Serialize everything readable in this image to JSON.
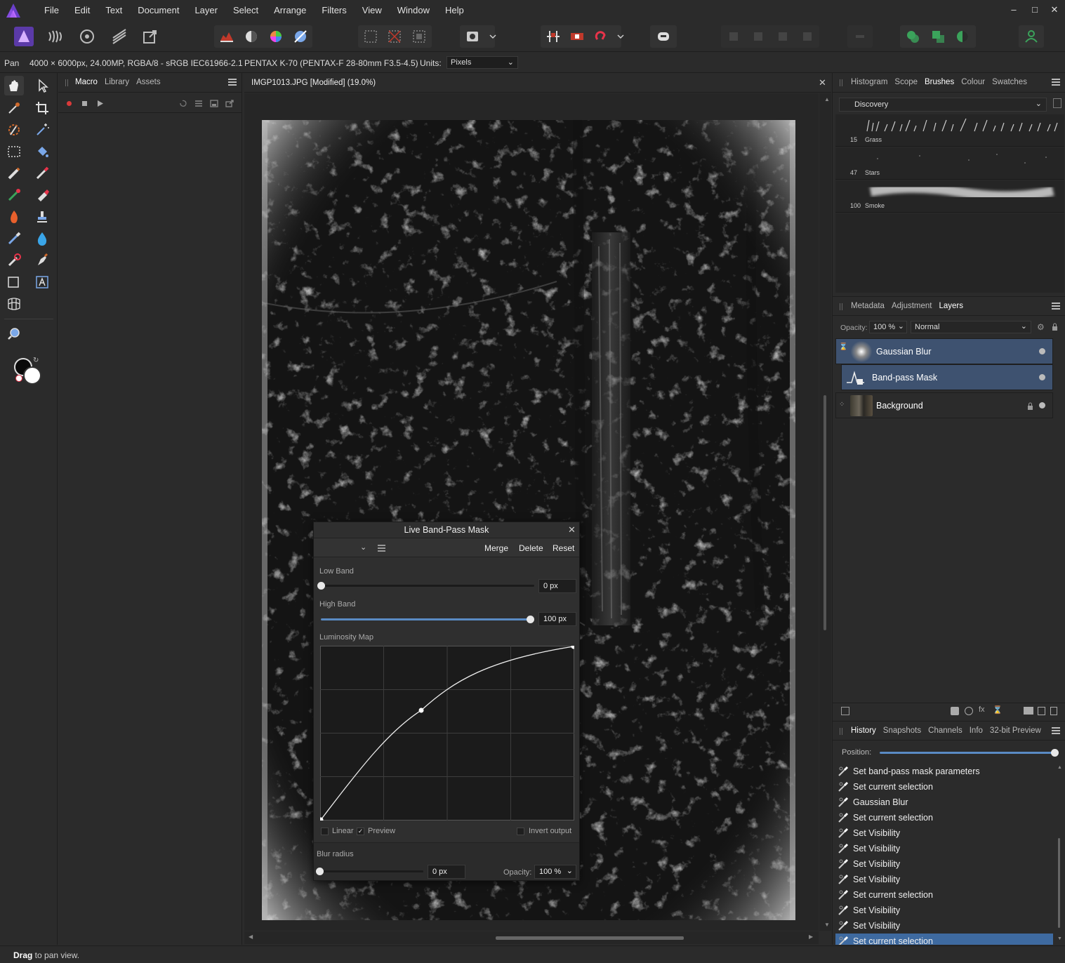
{
  "menu": [
    "File",
    "Edit",
    "Text",
    "Document",
    "Layer",
    "Select",
    "Arrange",
    "Filters",
    "View",
    "Window",
    "Help"
  ],
  "window_controls": {
    "minimize": "–",
    "maximize": "□",
    "close": "✕"
  },
  "context_bar": {
    "tool": "Pan",
    "doc_info": "4000 × 6000px, 24.00MP, RGBA/8 - sRGB IEC61966-2.1",
    "camera": "PENTAX K-70 (PENTAX-F 28-80mm F3.5-4.5)",
    "units_label": "Units:",
    "units_value": "Pixels"
  },
  "left_panel": {
    "tabs": [
      "Macro",
      "Library",
      "Assets"
    ],
    "active_tab": "Macro"
  },
  "document": {
    "tab_title": "IMGP1013.JPG [Modified] (19.0%)",
    "close": "✕"
  },
  "top_right_panel": {
    "tabs": [
      "Histogram",
      "Scope",
      "Brushes",
      "Colour",
      "Swatches"
    ],
    "active_tab": "Brushes",
    "category": "Discovery",
    "brushes": [
      {
        "count": "15",
        "name": "Grass"
      },
      {
        "count": "47",
        "name": "Stars"
      },
      {
        "count": "100",
        "name": "Smoke"
      }
    ]
  },
  "layers_panel": {
    "tabs": [
      "Metadata",
      "Adjustment",
      "Layers"
    ],
    "active_tab": "Layers",
    "opacity_label": "Opacity:",
    "opacity_value": "100 %",
    "blend_mode": "Normal",
    "layers": [
      {
        "name": "Gaussian Blur"
      },
      {
        "name": "Band-pass Mask"
      },
      {
        "name": "Background"
      }
    ]
  },
  "history_panel": {
    "tabs": [
      "History",
      "Snapshots",
      "Channels",
      "Info",
      "32-bit Preview"
    ],
    "active_tab": "History",
    "position_label": "Position:",
    "position_value": 1.0,
    "items": [
      "Set band-pass mask parameters",
      "Set current selection",
      "Gaussian Blur",
      "Set current selection",
      "Set Visibility",
      "Set Visibility",
      "Set Visibility",
      "Set Visibility",
      "Set current selection",
      "Set Visibility",
      "Set Visibility",
      "Set current selection"
    ],
    "selected_index": 11
  },
  "dialog": {
    "title": "Live Band-Pass Mask",
    "close": "✕",
    "merge": "Merge",
    "delete": "Delete",
    "reset": "Reset",
    "low_band_label": "Low Band",
    "low_band_value": "0 px",
    "low_band_fraction": 0.0,
    "high_band_label": "High Band",
    "high_band_value": "100 px",
    "high_band_fraction": 1.0,
    "luminosity_label": "Luminosity Map",
    "linear_label": "Linear",
    "linear_checked": false,
    "preview_label": "Preview",
    "preview_checked": true,
    "invert_label": "Invert output",
    "invert_checked": false,
    "blur_label": "Blur radius",
    "blur_value": "0 px",
    "blur_fraction": 0.0,
    "opacity_label": "Opacity:",
    "opacity_value": "100 %"
  },
  "status": {
    "bold": "Drag",
    "rest": " to pan view."
  },
  "colors": {
    "accent": "#5a8bc4",
    "selected_layer": "#3e5270",
    "selected_history": "#3e6aa0",
    "brand": "#7b3fe4"
  }
}
